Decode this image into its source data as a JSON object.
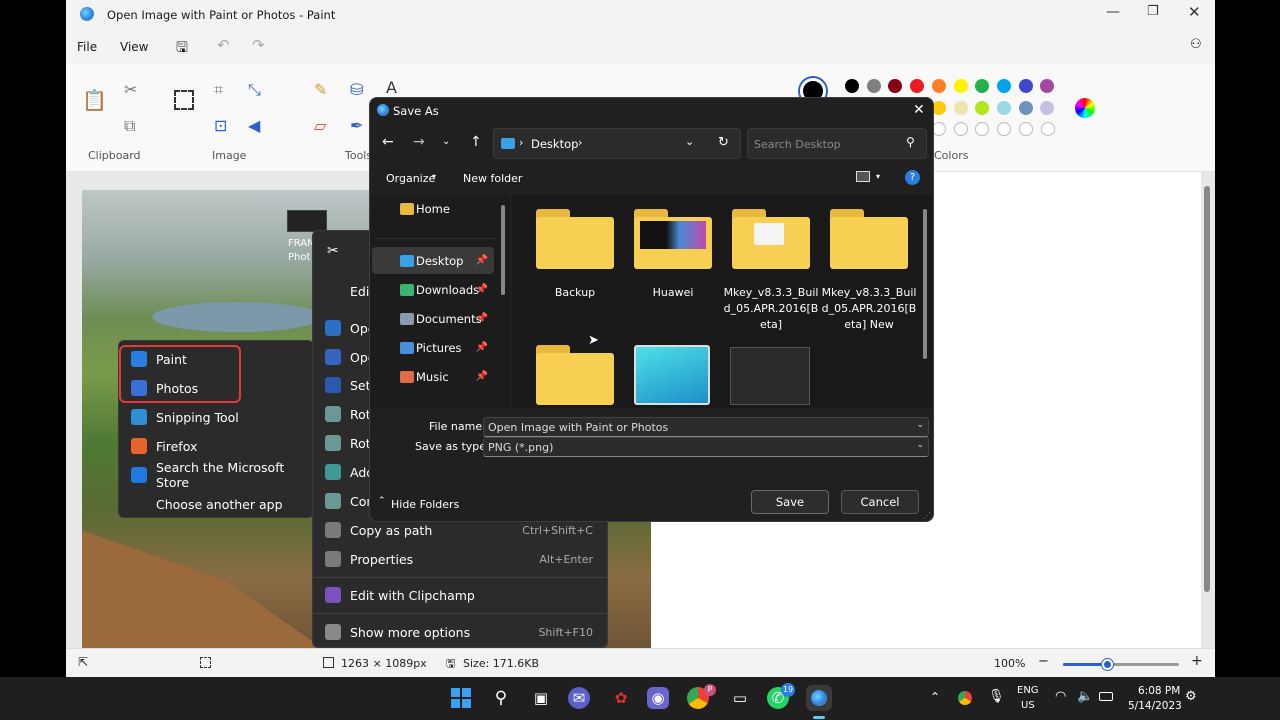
{
  "paint": {
    "title": "Open Image with Paint or Photos - Paint",
    "menu": {
      "file": "File",
      "view": "View"
    },
    "groups": {
      "clipboard": "Clipboard",
      "image": "Image",
      "tools": "Tools",
      "colors": "Colors"
    },
    "status": {
      "dimensions": "1263 × 1089px",
      "size": "Size: 171.6KB",
      "zoom": "100%"
    },
    "zoom_fraction": 0.38,
    "photo_label": "FRAN",
    "photo_label2": "Phot",
    "palette_row1": [
      "#000000",
      "#7f7f7f",
      "#880015",
      "#ed1c24",
      "#ff7f27",
      "#fff200",
      "#22b14c",
      "#00a2e8",
      "#3f48cc",
      "#a349a4"
    ],
    "palette_row2": [
      "#ffffff",
      "#c3c3c3",
      "#b97a57",
      "#ffaec9",
      "#ffc90e",
      "#efe4b0",
      "#b5e61d",
      "#99d9ea",
      "#7092be",
      "#c8bfe7"
    ]
  },
  "openwith_menu": {
    "items": [
      {
        "label": "Paint",
        "color": "#2a7de1"
      },
      {
        "label": "Photos",
        "color": "#3a6fd8"
      },
      {
        "label": "Snipping Tool",
        "color": "#2d8fd5"
      },
      {
        "label": "Firefox",
        "color": "#e8642a"
      },
      {
        "label": "Search the Microsoft Store",
        "color": "#1f7ae0"
      },
      {
        "label": "Choose another app",
        "color": ""
      }
    ]
  },
  "context_menu": {
    "items": [
      {
        "label": "Edit",
        "shortcut": ""
      },
      {
        "label": "Ope",
        "shortcut": ""
      },
      {
        "label": "Ope",
        "shortcut": ""
      },
      {
        "label": "Set",
        "shortcut": ""
      },
      {
        "label": "Rot",
        "shortcut": ""
      },
      {
        "label": "Rot",
        "shortcut": ""
      },
      {
        "label": "Add",
        "shortcut": ""
      },
      {
        "label": "Con",
        "shortcut": ""
      },
      {
        "label": "Copy as path",
        "shortcut": "Ctrl+Shift+C"
      },
      {
        "label": "Properties",
        "shortcut": "Alt+Enter"
      },
      {
        "label": "Edit with Clipchamp",
        "shortcut": ""
      },
      {
        "label": "Show more options",
        "shortcut": "Shift+F10"
      }
    ]
  },
  "dialog": {
    "title": "Save As",
    "breadcrumb": "Desktop",
    "search_placeholder": "Search Desktop",
    "organize": "Organize",
    "new_folder": "New folder",
    "nav": [
      {
        "label": "Home",
        "color": "#e8b93c"
      },
      {
        "label": "Desktop",
        "color": "#3aa0e8"
      },
      {
        "label": "Downloads",
        "color": "#3cb371"
      },
      {
        "label": "Documents",
        "color": "#8a9ab0"
      },
      {
        "label": "Pictures",
        "color": "#4a90d9"
      },
      {
        "label": "Music",
        "color": "#e06b4a"
      }
    ],
    "files": [
      {
        "label": "Backup"
      },
      {
        "label": "Huawei"
      },
      {
        "label": "Mkey_v8.3.3_Build_05.APR.2016[Beta]"
      },
      {
        "label": "Mkey_v8.3.3_Build_05.APR.2016[Beta] New"
      }
    ],
    "file_name_label": "File name:",
    "file_name_value": "Open Image with Paint or Photos",
    "save_type_label": "Save as type:",
    "save_type_value": "PNG (*.png)",
    "hide_folders": "Hide Folders",
    "save": "Save",
    "cancel": "Cancel"
  },
  "taskbar": {
    "lang1": "ENG",
    "lang2": "US",
    "time": "6:08 PM",
    "date": "5/14/2023",
    "whatsapp_badge": "19",
    "chrome_badge": "P"
  }
}
